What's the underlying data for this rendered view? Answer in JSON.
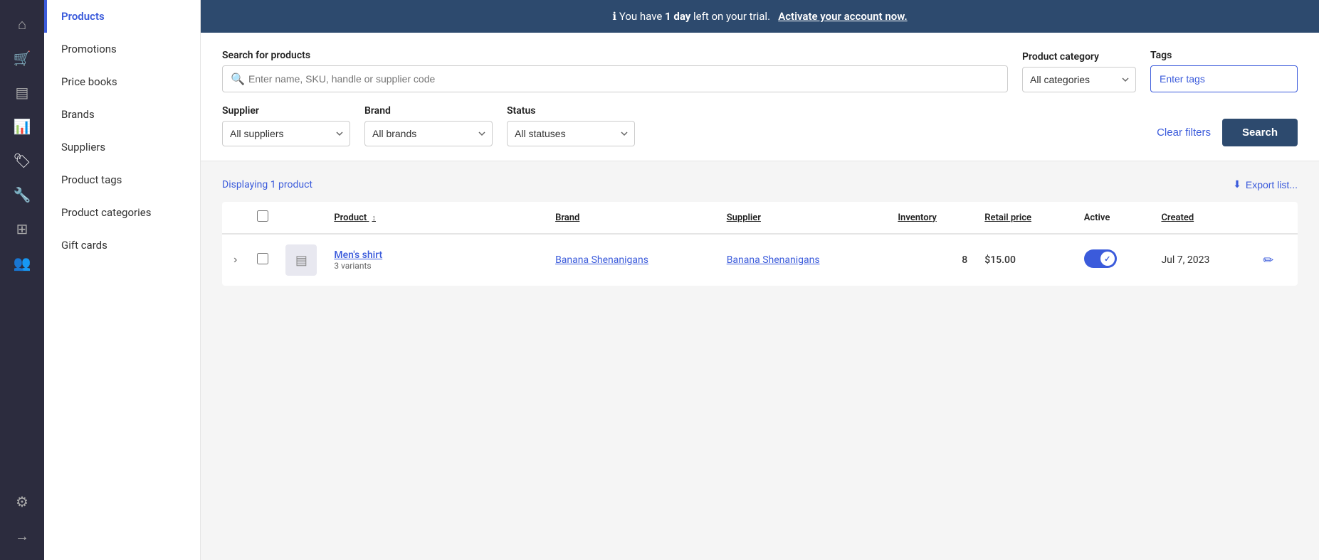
{
  "iconSidebar": {
    "icons": [
      {
        "name": "home-icon",
        "symbol": "⌂",
        "active": false
      },
      {
        "name": "cart-icon",
        "symbol": "🛒",
        "active": false
      },
      {
        "name": "layers-icon",
        "symbol": "▤",
        "active": false
      },
      {
        "name": "chart-icon",
        "symbol": "📊",
        "active": false
      },
      {
        "name": "tag-icon",
        "symbol": "🏷",
        "active": true
      },
      {
        "name": "wrench-icon",
        "symbol": "🔧",
        "active": false
      },
      {
        "name": "grid-icon",
        "symbol": "⊞",
        "active": false
      },
      {
        "name": "users-icon",
        "symbol": "👥",
        "active": false
      },
      {
        "name": "settings-icon",
        "symbol": "⚙",
        "active": false
      },
      {
        "name": "arrow-right-icon",
        "symbol": "→",
        "active": false
      }
    ]
  },
  "navSidebar": {
    "items": [
      {
        "label": "Products",
        "active": true
      },
      {
        "label": "Promotions",
        "active": false
      },
      {
        "label": "Price books",
        "active": false
      },
      {
        "label": "Brands",
        "active": false
      },
      {
        "label": "Suppliers",
        "active": false
      },
      {
        "label": "Product tags",
        "active": false
      },
      {
        "label": "Product categories",
        "active": false
      },
      {
        "label": "Gift cards",
        "active": false
      }
    ]
  },
  "trialBanner": {
    "prefix": "You have ",
    "bold": "1 day",
    "suffix": " left on your trial.",
    "linkText": "Activate your account now.",
    "infoSymbol": "ℹ"
  },
  "filters": {
    "searchLabel": "Search for products",
    "searchPlaceholder": "Enter name, SKU, handle or supplier code",
    "categoryLabel": "Product category",
    "categoryDefault": "All categories",
    "categoryOptions": [
      "All categories"
    ],
    "tagsLabel": "Tags",
    "tagsPlaceholder": "Enter tags",
    "supplierLabel": "Supplier",
    "supplierDefault": "All suppliers",
    "supplierOptions": [
      "All suppliers"
    ],
    "brandLabel": "Brand",
    "brandDefault": "All brands",
    "brandOptions": [
      "All brands"
    ],
    "statusLabel": "Status",
    "statusDefault": "All statuses",
    "statusOptions": [
      "All statuses"
    ],
    "clearFiltersLabel": "Clear filters",
    "searchButtonLabel": "Search"
  },
  "productsList": {
    "displayingText": "Displaying 1 product",
    "exportLabel": "Export list...",
    "exportIcon": "⬇",
    "table": {
      "columns": [
        {
          "label": "",
          "key": "expand",
          "underline": false
        },
        {
          "label": "",
          "key": "checkbox",
          "underline": false
        },
        {
          "label": "",
          "key": "thumbnail",
          "underline": false
        },
        {
          "label": "Product",
          "key": "product",
          "underline": true,
          "sortable": true
        },
        {
          "label": "Brand",
          "key": "brand",
          "underline": true
        },
        {
          "label": "Supplier",
          "key": "supplier",
          "underline": true
        },
        {
          "label": "Inventory",
          "key": "inventory",
          "underline": true
        },
        {
          "label": "Retail price",
          "key": "retailPrice",
          "underline": true
        },
        {
          "label": "Active",
          "key": "active",
          "underline": false
        },
        {
          "label": "Created",
          "key": "created",
          "underline": true
        },
        {
          "label": "",
          "key": "actions",
          "underline": false
        }
      ],
      "rows": [
        {
          "id": 1,
          "productName": "Men's shirt",
          "productVariants": "3 variants",
          "brand": "Banana Shenanigans",
          "supplier": "Banana Shenanigans",
          "inventory": "8",
          "retailPrice": "$15.00",
          "active": true,
          "created": "Jul 7, 2023"
        }
      ]
    }
  }
}
